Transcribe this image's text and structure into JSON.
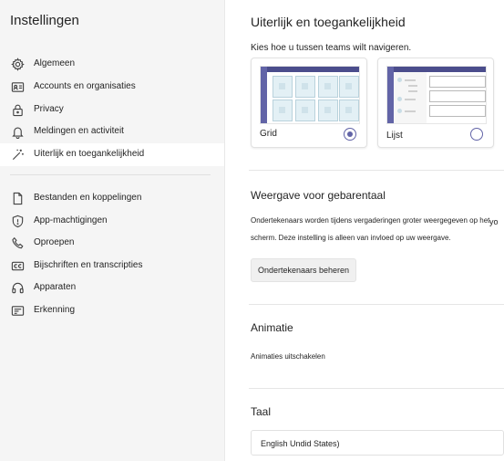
{
  "sidebar": {
    "title": "Instellingen",
    "items": [
      {
        "label": "Algemeen",
        "icon": "gear-icon"
      },
      {
        "label": "Accounts en organisaties",
        "icon": "id-card-icon"
      },
      {
        "label": "Privacy",
        "icon": "lock-icon"
      },
      {
        "label": "Meldingen en activiteit",
        "icon": "bell-icon"
      },
      {
        "label": "Uiterlijk en toegankelijkheid",
        "icon": "magic-wand-icon",
        "selected": true
      },
      {
        "label": "Bestanden en koppelingen",
        "icon": "document-icon"
      },
      {
        "label": "App-machtigingen",
        "icon": "shield-icon"
      },
      {
        "label": "Oproepen",
        "icon": "phone-icon"
      },
      {
        "label": "Bijschriften en transcripties",
        "icon": "closed-captions-icon"
      },
      {
        "label": "Apparaten",
        "icon": "headset-icon"
      },
      {
        "label": "Erkenning",
        "icon": "certificate-icon"
      }
    ]
  },
  "main": {
    "title": "Uiterlijk en toegankelijkheid",
    "intro": "Kies hoe u tussen teams wilt navigeren.",
    "layout_options": [
      {
        "label": "Grid",
        "selected": true
      },
      {
        "label": "Lijst",
        "selected": false
      }
    ],
    "sign_language": {
      "title": "Weergave voor gebarentaal",
      "line1": "Ondertekenaars worden tijdens vergaderingen groter weergegeven op het",
      "line1_overflow": "yo",
      "line2": "scherm. Deze instelling is alleen van invloed op uw weergave.",
      "button": "Ondertekenaars beheren"
    },
    "animation": {
      "title": "Animatie",
      "toggle_label": "Animaties uitschakelen"
    },
    "language": {
      "title": "Taal",
      "selected": "English Undid States)"
    }
  },
  "colors": {
    "accent": "#6264a7",
    "sidebar_bg": "#f5f5f5",
    "selected_bg": "#ffffff"
  }
}
